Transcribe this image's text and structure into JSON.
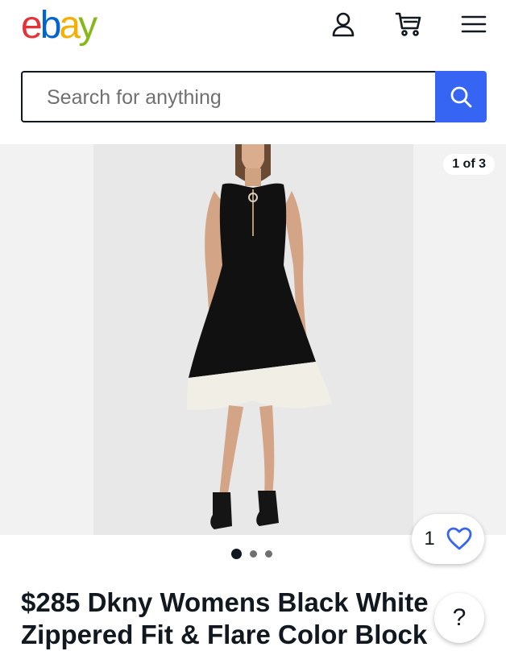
{
  "header": {
    "logo": [
      "e",
      "b",
      "a",
      "y"
    ],
    "logo_colors": [
      "#e53238",
      "#0064d2",
      "#f5af02",
      "#86b817"
    ],
    "icons": [
      "user-icon",
      "cart-icon",
      "menu-icon"
    ]
  },
  "search": {
    "placeholder": "Search for anything",
    "value": "",
    "button_icon": "search-icon",
    "accent": "#3665f3"
  },
  "gallery": {
    "counter": "1 of 3",
    "total_images": 3,
    "active_index": 1
  },
  "watch": {
    "count": "1",
    "icon": "heart-outline-icon"
  },
  "listing": {
    "title": "$285 Dkny Womens Black White Zippered Fit & Flare Color Block"
  },
  "help": {
    "label": "?"
  }
}
